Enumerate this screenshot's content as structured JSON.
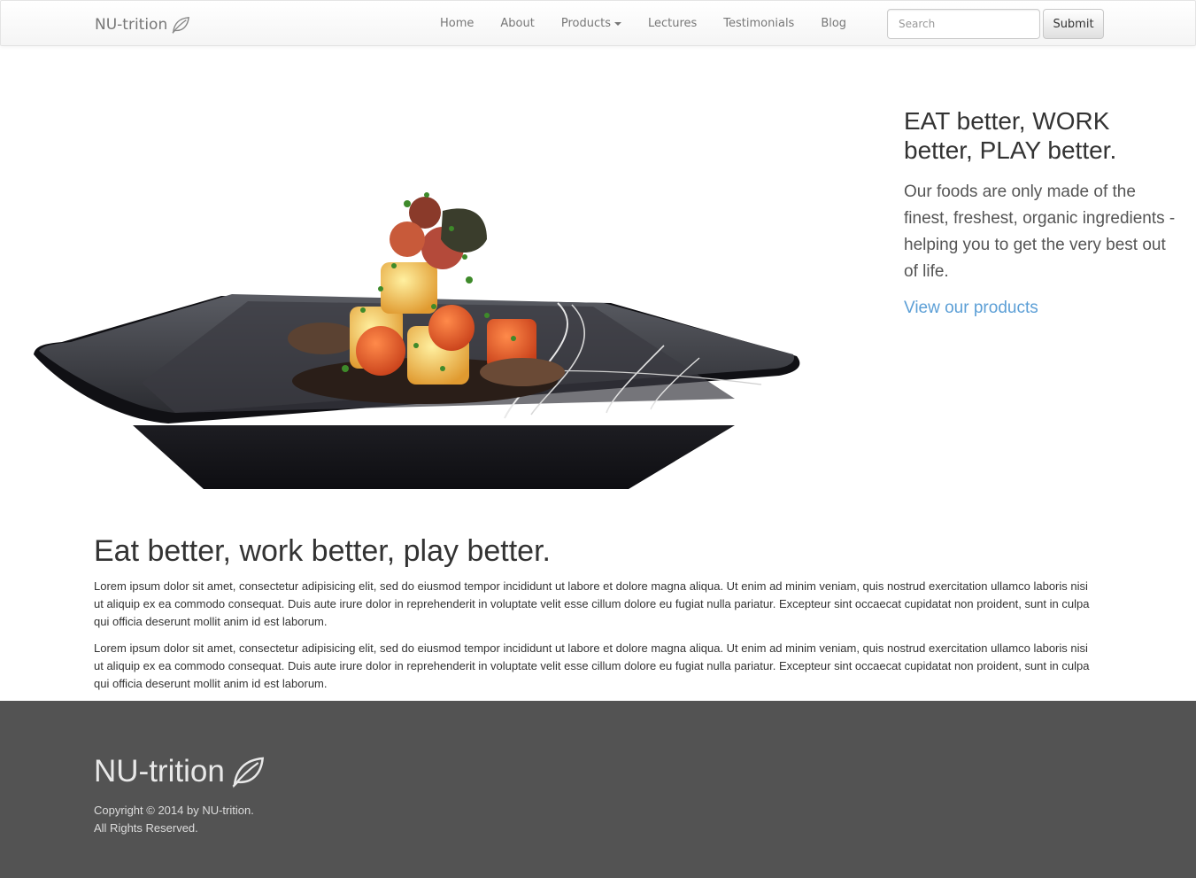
{
  "navbar": {
    "brand": "NU-trition",
    "brand_icon": "leaf-icon",
    "links": [
      {
        "label": "Home"
      },
      {
        "label": "About"
      },
      {
        "label": "Products"
      },
      {
        "label": "Lectures"
      },
      {
        "label": "Testimonials"
      },
      {
        "label": "Blog"
      }
    ],
    "search_placeholder": "Search",
    "search_value": "",
    "submit_label": "Submit"
  },
  "hero": {
    "image": "food-on-black-plate",
    "heading": "EAT better, WORK better, PLAY better.",
    "lead": "Our foods are only made of the finest, freshest, organic ingredients - helping you to get the very best out of life.",
    "link": "View our products"
  },
  "main": {
    "title": "Eat better, work better, play better.",
    "paragraphs": [
      "Lorem ipsum dolor sit amet, consectetur adipisicing elit, sed do eiusmod tempor incididunt ut labore et dolore magna aliqua. Ut enim ad minim veniam, quis nostrud exercitation ullamco laboris nisi ut aliquip ex ea commodo consequat. Duis aute irure dolor in reprehenderit in voluptate velit esse cillum dolore eu fugiat nulla pariatur. Excepteur sint occaecat cupidatat non proident, sunt in culpa qui officia deserunt mollit anim id est laborum.",
      "Lorem ipsum dolor sit amet, consectetur adipisicing elit, sed do eiusmod tempor incididunt ut labore et dolore magna aliqua. Ut enim ad minim veniam, quis nostrud exercitation ullamco laboris nisi ut aliquip ex ea commodo consequat. Duis aute irure dolor in reprehenderit in voluptate velit esse cillum dolore eu fugiat nulla pariatur. Excepteur sint occaecat cupidatat non proident, sunt in culpa qui officia deserunt mollit anim id est laborum."
    ]
  },
  "footer": {
    "brand": "NU-trition",
    "copyright_line1": "Copyright © 2014 by NU-trition.",
    "copyright_line2": "All Rights Reserved."
  },
  "colors": {
    "link": "#5c9fd6",
    "footer_bg": "#535353",
    "navbar_text": "#777777"
  }
}
